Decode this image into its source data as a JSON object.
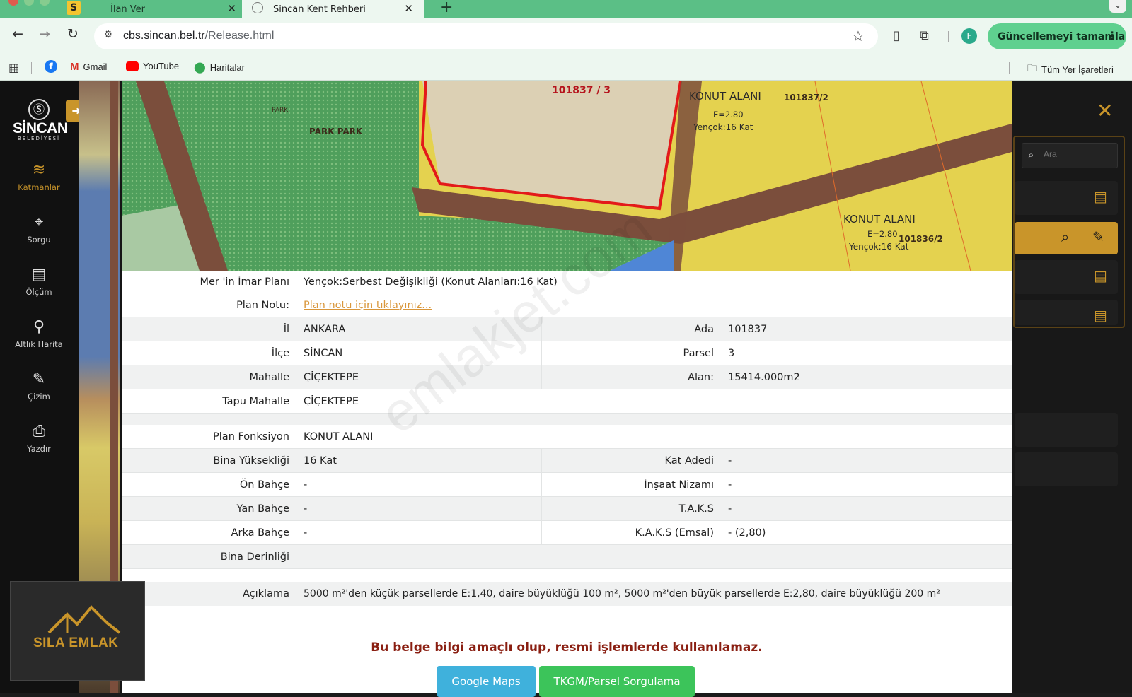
{
  "browser": {
    "tabs": [
      {
        "label": "İlan Ver",
        "favicon": "S"
      },
      {
        "label": "Sincan Kent Rehberi"
      }
    ],
    "url_host": "cbs.sincan.bel.tr",
    "url_path": "/Release.html",
    "profile_initial": "F",
    "update_label": "Güncellemeyi tamamla",
    "bookmarks": [
      {
        "label": "Gmail"
      },
      {
        "label": "YouTube"
      },
      {
        "label": "Haritalar"
      }
    ],
    "all_bookmarks_label": "Tüm Yer İşaretleri"
  },
  "sidebar": {
    "logo_name": "SİNCAN",
    "logo_sub": "BELEDİYESİ",
    "items": [
      {
        "label": "Katmanlar",
        "icon": "layers-icon"
      },
      {
        "label": "Sorgu",
        "icon": "location-pin-icon"
      },
      {
        "label": "Ölçüm",
        "icon": "ruler-icon"
      },
      {
        "label": "Altlık Harita",
        "icon": "map-pin-icon"
      },
      {
        "label": "Çizim",
        "icon": "pencil-icon"
      },
      {
        "label": "Yazdır",
        "icon": "printer-icon"
      }
    ]
  },
  "map": {
    "parcel_label": "101837 / 3",
    "park_label": "PARK PARK",
    "park_small": "PARK",
    "zone1": {
      "title": "KONUT ALANI",
      "e": "E=2.80",
      "floors": "Yençok:16 Kat",
      "code": "101837/2"
    },
    "zone2": {
      "title": "KONUT ALANI",
      "e": "E=2.80",
      "floors": "Yençok:16 Kat",
      "code": "101836/2"
    }
  },
  "search": {
    "placeholder": "Ara"
  },
  "info": {
    "imar_label": "Mer 'in İmar Planı",
    "imar_value": "Yençok:Serbest Değişikliği (Konut Alanları:16 Kat)",
    "plan_notu_label": "Plan Notu:",
    "plan_notu_link": "Plan notu için tıklayınız...",
    "il_label": "İl",
    "il_value": "ANKARA",
    "ada_label": "Ada",
    "ada_value": "101837",
    "ilce_label": "İlçe",
    "ilce_value": "SİNCAN",
    "parsel_label": "Parsel",
    "parsel_value": "3",
    "mahalle_label": "Mahalle",
    "mahalle_value": "ÇİÇEKTEPE",
    "alan_label": "Alan:",
    "alan_value": "15414.000m2",
    "tapu_label": "Tapu Mahalle",
    "tapu_value": "ÇİÇEKTEPE",
    "fonksiyon_label": "Plan Fonksiyon",
    "fonksiyon_value": "KONUT ALANI",
    "yukseklik_label": "Bina Yüksekliği",
    "yukseklik_value": "16 Kat",
    "kat_label": "Kat Adedi",
    "kat_value": "-",
    "on_label": "Ön Bahçe",
    "on_value": "-",
    "nizam_label": "İnşaat Nizamı",
    "nizam_value": "-",
    "yan_label": "Yan Bahçe",
    "yan_value": "-",
    "taks_label": "T.A.K.S",
    "taks_value": "-",
    "arka_label": "Arka Bahçe",
    "arka_value": "-",
    "kaks_label": "K.A.K.S (Emsal)",
    "kaks_value": "- (2,80)",
    "derinlik_label": "Bina Derinliği",
    "aciklama_label": "Açıklama",
    "aciklama_value": "5000 m²'den küçük parsellerde E:1,40, daire büyüklüğü 100 m², 5000 m²'den büyük parsellerde E:2,80, daire büyüklüğü 200 m²",
    "disclaimer": "Bu belge bilgi amaçlı olup, resmi işlemlerde kullanılamaz.",
    "gmaps_button": "Google Maps",
    "tkgm_button": "TKGM/Parsel Sorgulama"
  },
  "watermark": "emlakjet.com",
  "overlay_logo": "SILA EMLAK",
  "colors": {
    "accent": "#c9952a",
    "chrome": "#5bbf86",
    "link": "#d9963a",
    "disclaimer": "#8a1f12"
  }
}
